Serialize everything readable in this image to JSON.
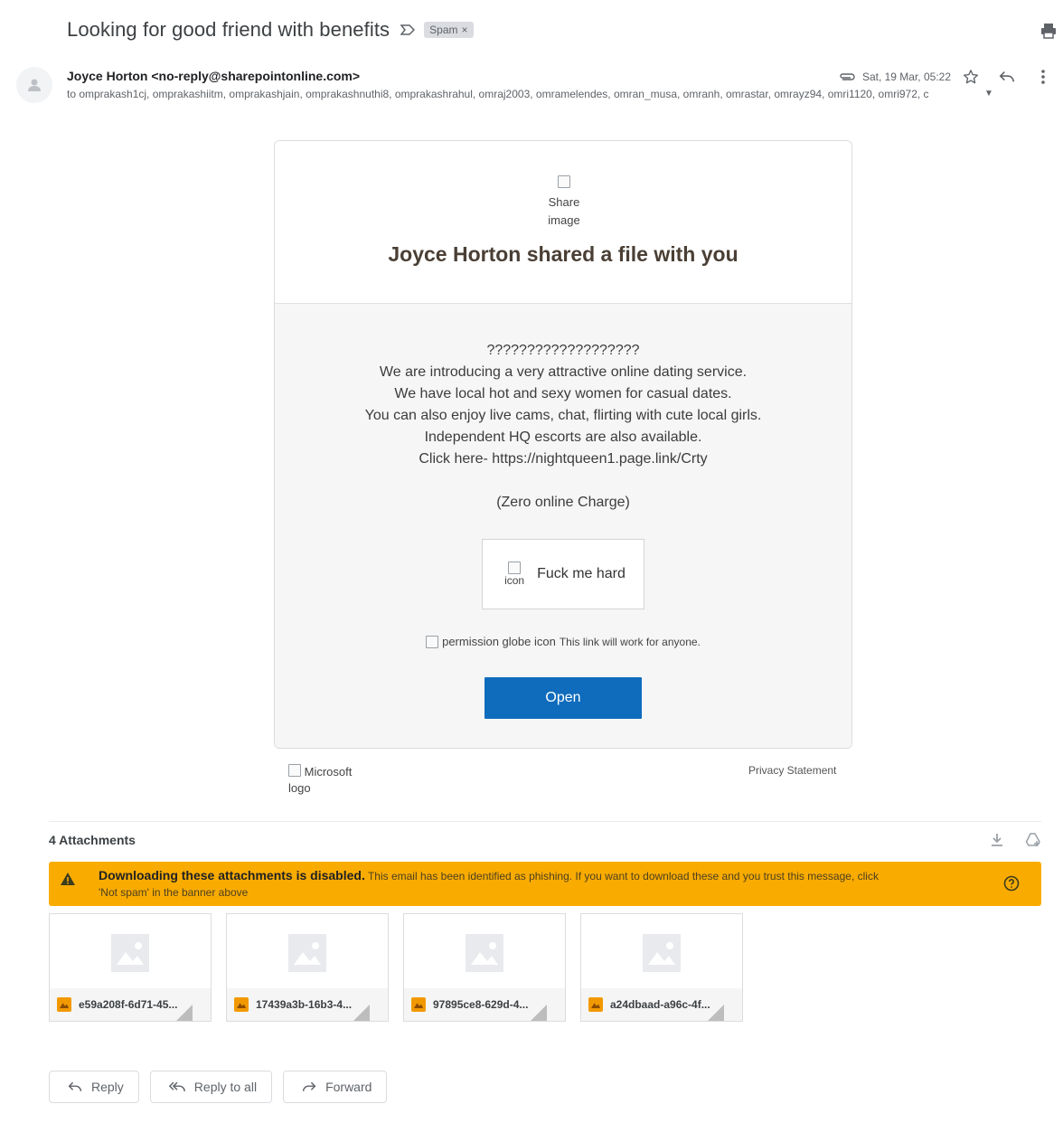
{
  "email": {
    "subject": "Looking for good friend with benefits",
    "label": "Spam",
    "label_close": "×",
    "sender": "Joyce Horton <no-reply@sharepointonline.com>",
    "recipients": "to omprakash1cj, omprakashiitm, omprakashjain, omprakashnuthi8, omprakashrahul, omraj2003, omramelendes, omran_musa, omranh, omrastar, omrayz94, omri1120, omri972, c",
    "date": "Sat, 19 Mar, 05:22"
  },
  "card": {
    "share_image_alt": "Share image",
    "share_title": "Joyce Horton shared a file with you",
    "message_lines": [
      "???????????????????",
      "We are introducing a very attractive online dating service.",
      "We have local hot and sexy women for casual dates.",
      "You can also enjoy live cams, chat, flirting with cute local girls.",
      "Independent HQ escorts are also available.",
      "Click here- https://nightqueen1.page.link/Crty"
    ],
    "charge_line": "(Zero online Charge)",
    "file_icon_alt": "icon",
    "file_label": "Fuck me hard",
    "permission_icon_alt": "permission globe icon",
    "permission_text": "This link will work for anyone.",
    "open_button": "Open"
  },
  "footer": {
    "microsoft_logo_alt": "Microsoft logo",
    "privacy": "Privacy Statement"
  },
  "attachments": {
    "header": "4 Attachments",
    "warning_bold": "Downloading these attachments is disabled.",
    "warning_text": " This email has been identified as phishing. If you want to download these and you trust this message, click 'Not spam' in the banner above",
    "files": [
      {
        "name": "e59a208f-6d71-45..."
      },
      {
        "name": "17439a3b-16b3-4..."
      },
      {
        "name": "97895ce8-629d-4..."
      },
      {
        "name": "a24dbaad-a96c-4f..."
      }
    ]
  },
  "actions": {
    "reply": "Reply",
    "reply_all": "Reply to all",
    "forward": "Forward"
  },
  "colors": {
    "warning_banner": "#f9ab00",
    "open_button": "#0f6cbd",
    "spam_chip": "#dadce0"
  },
  "icons": [
    "important-marker-icon",
    "print-icon",
    "avatar-icon",
    "attachment-clip-icon",
    "star-icon",
    "reply-icon",
    "more-vert-icon",
    "download-all-icon",
    "add-to-drive-icon",
    "warning-icon",
    "help-icon",
    "image-file-icon",
    "reply-all-icon",
    "forward-icon"
  ]
}
